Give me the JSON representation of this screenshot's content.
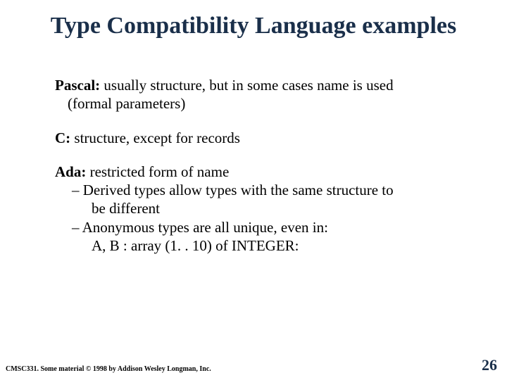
{
  "title": "Type Compatibility Language examples",
  "entries": {
    "pascal": {
      "name": "Pascal:",
      "text": " usually structure, but in some cases name is used",
      "cont": "(formal parameters)"
    },
    "c": {
      "name": "C:",
      "text": " structure, except for records"
    },
    "ada": {
      "name": "Ada:",
      "text": " restricted form of name",
      "bullet1a": "– Derived types allow types with the same structure to",
      "bullet1b": "be different",
      "bullet2": "– Anonymous types are all unique, even in:",
      "example": "A, B : array (1. . 10) of INTEGER:"
    }
  },
  "footer": "CMSC331. Some material © 1998 by Addison Wesley Longman, Inc.",
  "page": "26"
}
